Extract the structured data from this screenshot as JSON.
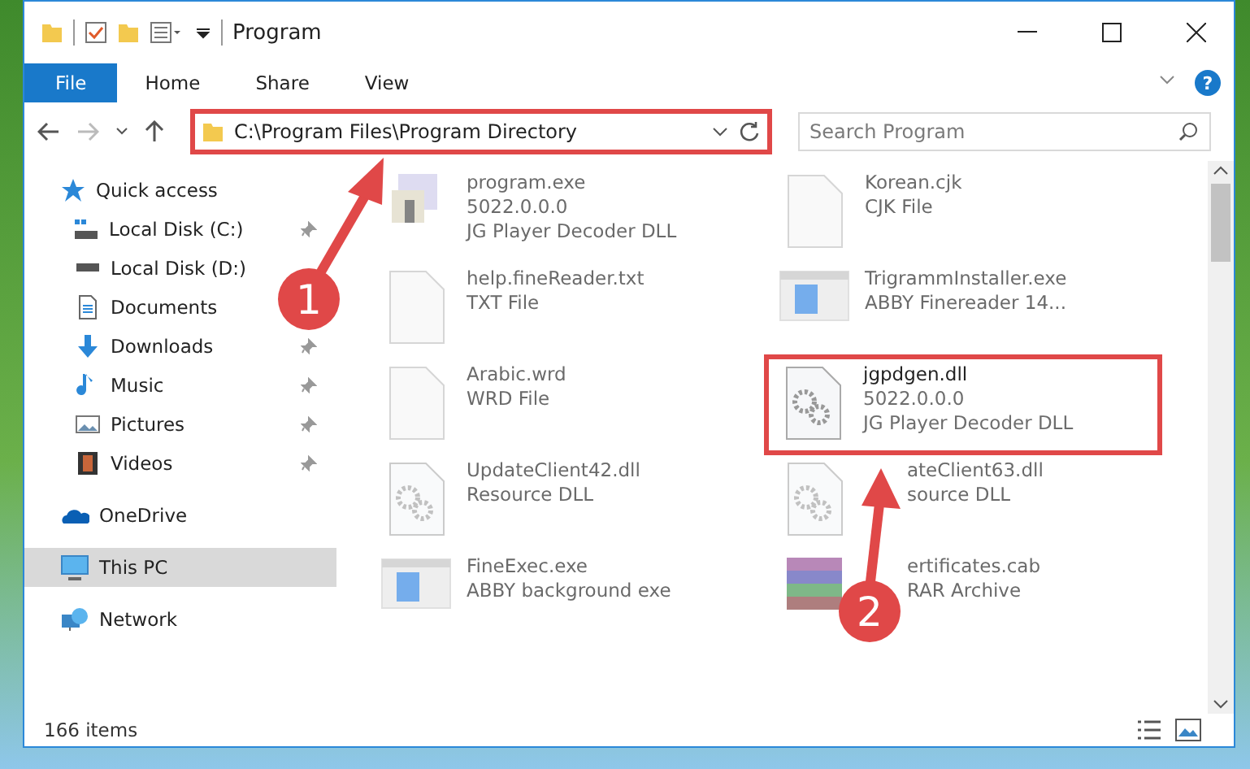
{
  "window": {
    "title": "Program"
  },
  "ribbon": {
    "tabs": [
      {
        "label": "File",
        "selected": true
      },
      {
        "label": "Home",
        "selected": false
      },
      {
        "label": "Share",
        "selected": false
      },
      {
        "label": "View",
        "selected": false
      }
    ],
    "help": "?"
  },
  "address": {
    "path": "C:\\Program Files\\Program Directory",
    "highlighted": true
  },
  "search": {
    "placeholder": "Search Program"
  },
  "sidebar": {
    "items": [
      {
        "label": "Quick access",
        "kind": "star",
        "selected": false,
        "children": [
          {
            "label": "Local Disk (C:)",
            "kind": "drive-c",
            "pinned": true,
            "selected": false
          },
          {
            "label": "Local Disk (D:)",
            "kind": "drive",
            "selected": false
          },
          {
            "label": "Documents",
            "kind": "documents",
            "selected": false
          },
          {
            "label": "Downloads",
            "kind": "downloads",
            "pinned": true,
            "selected": false
          },
          {
            "label": "Music",
            "kind": "music",
            "pinned": true,
            "selected": false
          },
          {
            "label": "Pictures",
            "kind": "pictures",
            "pinned": true,
            "selected": false
          },
          {
            "label": "Videos",
            "kind": "videos",
            "pinned": true,
            "selected": false
          }
        ]
      },
      {
        "label": "OneDrive",
        "kind": "cloud",
        "selected": false
      },
      {
        "label": "This PC",
        "kind": "pc",
        "selected": true
      },
      {
        "label": "Network",
        "kind": "network",
        "selected": false
      }
    ]
  },
  "files": [
    {
      "name": "program.exe",
      "details": [
        "5022.0.0.0",
        "JG Player Decoder DLL"
      ],
      "kind": "app",
      "dimmed": true,
      "highlighted": false,
      "partly_hidden": false
    },
    {
      "name": "Korean.cjk",
      "details": [
        "CJK File"
      ],
      "kind": "blank",
      "dimmed": true,
      "highlighted": false,
      "partly_hidden": false
    },
    {
      "name": "help.fineReader.txt",
      "details": [
        "TXT File"
      ],
      "kind": "blank",
      "dimmed": true,
      "highlighted": false,
      "partly_hidden": false
    },
    {
      "name": "TrigrammInstaller.exe",
      "details": [
        "ABBY Finereader 14..."
      ],
      "kind": "window",
      "dimmed": true,
      "highlighted": false,
      "partly_hidden": false
    },
    {
      "name": "Arabic.wrd",
      "details": [
        "WRD File"
      ],
      "kind": "blank",
      "dimmed": true,
      "highlighted": false,
      "partly_hidden": false
    },
    {
      "name": "jgpdgen.dll",
      "details": [
        "5022.0.0.0",
        "JG Player Decoder DLL"
      ],
      "kind": "gears",
      "dimmed": false,
      "highlighted": true,
      "partly_hidden": false
    },
    {
      "name": "UpdateClient42.dll",
      "details": [
        "Resource DLL"
      ],
      "kind": "gears",
      "dimmed": true,
      "highlighted": false,
      "partly_hidden": false
    },
    {
      "name": "ateClient63.dll",
      "details": [
        "source DLL"
      ],
      "kind": "gears",
      "dimmed": true,
      "highlighted": false,
      "partly_hidden": true
    },
    {
      "name": "FineExec.exe",
      "details": [
        "ABBY background exe"
      ],
      "kind": "window",
      "dimmed": true,
      "highlighted": false,
      "partly_hidden": false
    },
    {
      "name": "ertificates.cab",
      "details": [
        "RAR Archive"
      ],
      "kind": "archive",
      "dimmed": true,
      "highlighted": false,
      "partly_hidden": true
    }
  ],
  "status_bar": {
    "count": "166 items"
  },
  "callouts": [
    {
      "number": "1"
    },
    {
      "number": "2"
    }
  ]
}
